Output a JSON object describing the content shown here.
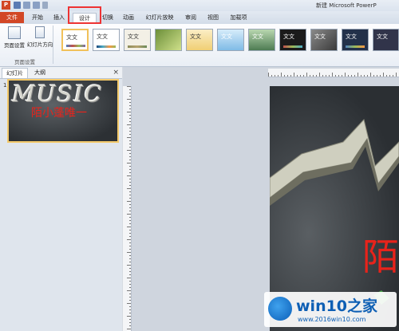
{
  "window": {
    "title": "新建 Microsoft PowerP"
  },
  "tabs": [
    {
      "label": "文件"
    },
    {
      "label": "开始"
    },
    {
      "label": "插入"
    },
    {
      "label": "设计"
    },
    {
      "label": "切换"
    },
    {
      "label": "动画"
    },
    {
      "label": "幻灯片放映"
    },
    {
      "label": "审阅"
    },
    {
      "label": "视图"
    },
    {
      "label": "加载项"
    }
  ],
  "ribbon": {
    "page_setup_label": "页面设置",
    "orientation_label": "幻灯片方向",
    "group_label": "页面设置",
    "themes": [
      {
        "label": "文文"
      },
      {
        "label": "文文"
      },
      {
        "label": "文文"
      },
      {
        "label": ""
      },
      {
        "label": "文文"
      },
      {
        "label": "文文"
      },
      {
        "label": "文文"
      },
      {
        "label": "文文"
      },
      {
        "label": "文文"
      },
      {
        "label": "文文"
      },
      {
        "label": "文文"
      }
    ]
  },
  "left_panel": {
    "tab_slides": "幻灯片",
    "tab_outline": "大纲",
    "close_glyph": "×",
    "slide_number": "1",
    "thumb_title": "陌小蓬唯一",
    "thumb_art": "MUSIC"
  },
  "slide": {
    "big_text": "陌"
  },
  "watermark": {
    "brand": "win10之家",
    "url": "www.2016win10.com"
  },
  "colors": {
    "accent_file_tab": "#d24726",
    "highlight": "#e33333",
    "slide_text": "#e8231b",
    "selection": "#f3c96a"
  }
}
